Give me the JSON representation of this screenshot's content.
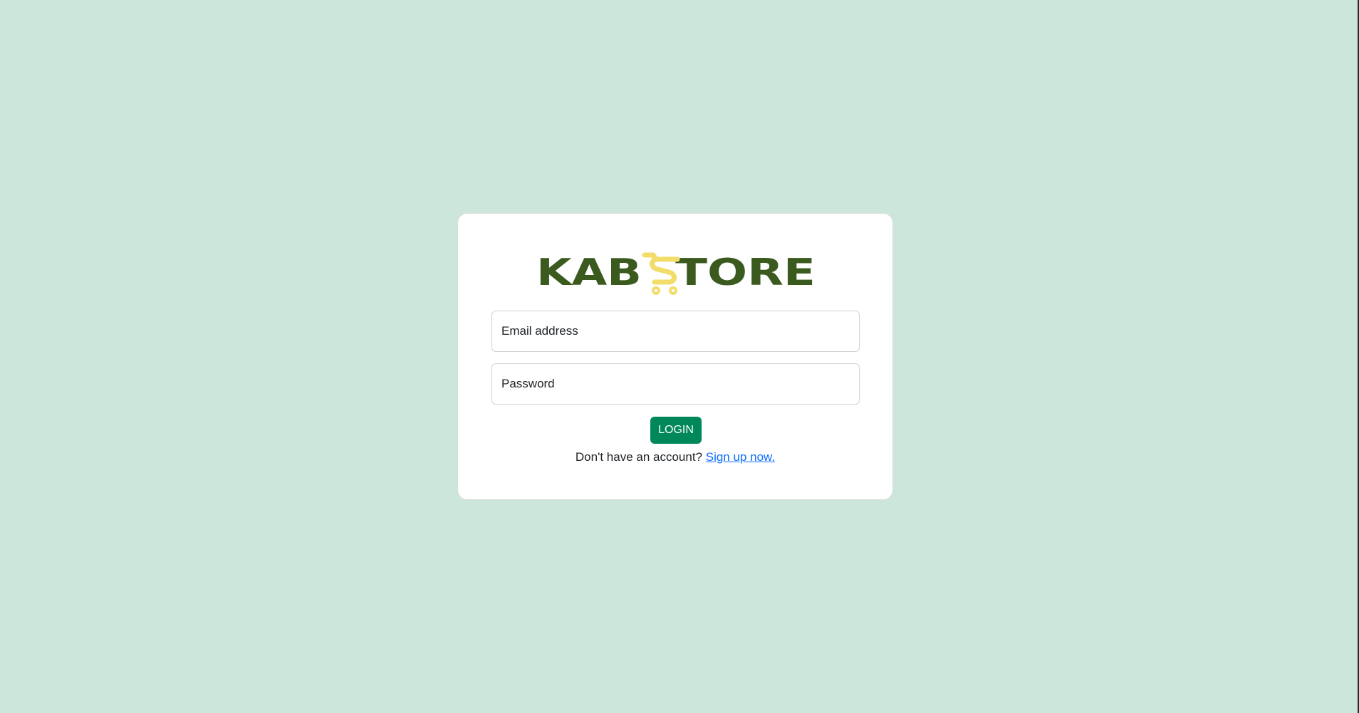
{
  "brand": {
    "logo_text": "KABSTORE",
    "colors": {
      "logo_primary": "#3b5a1e",
      "logo_accent": "#f2dd6a",
      "background": "#cde6dc",
      "button": "#00875a",
      "link": "#0d6efd"
    }
  },
  "login_form": {
    "email_placeholder": "Email address",
    "password_placeholder": "Password",
    "login_button_label": "LOGIN",
    "signup_prompt": "Don't have an account?",
    "signup_link": "Sign up now."
  }
}
